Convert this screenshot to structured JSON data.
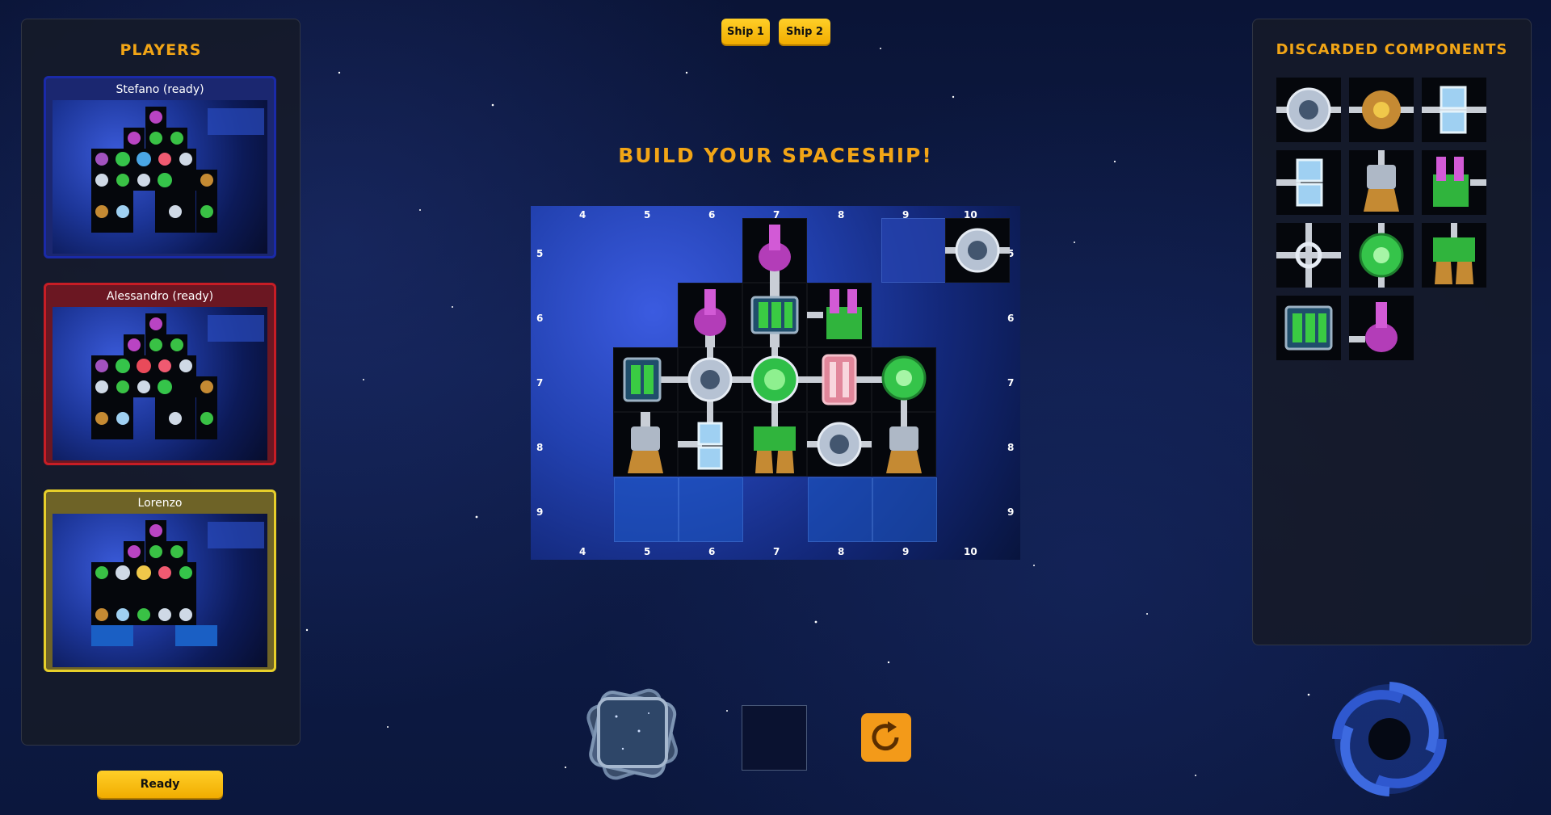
{
  "tabs": [
    {
      "label": "Ship 1"
    },
    {
      "label": "Ship 2"
    }
  ],
  "players_panel": {
    "title": "Players",
    "players": [
      {
        "name": "Stefano (ready)",
        "border": "#1a2aa8",
        "bg": "#1b2770"
      },
      {
        "name": "Alessandro (ready)",
        "border": "#c71d25",
        "bg": "#6b1722"
      },
      {
        "name": "Lorenzo",
        "border": "#e7cf2a",
        "bg": "#6e6327"
      }
    ]
  },
  "ready_button": "Ready",
  "main": {
    "title": "BUILD YOUR SPACESHIP!",
    "columns": [
      "4",
      "5",
      "6",
      "7",
      "8",
      "9",
      "10"
    ],
    "rows": [
      "5",
      "6",
      "7",
      "8",
      "9"
    ]
  },
  "discard_panel": {
    "title": "Discarded Components",
    "items": [
      "cabin-component",
      "battery-component",
      "storage-component",
      "storage-component",
      "engine-component",
      "cannon-component",
      "pipe-connector-component",
      "alien-cabin-component",
      "engine-component",
      "battery-component",
      "cannon-component"
    ]
  },
  "bottom": {
    "deck_icon": "card-deck-icon",
    "held_slot": "held-component-slot",
    "rotate_icon": "rotate-icon",
    "wormhole_icon": "black-hole-icon"
  },
  "colors": {
    "accent": "#f2a516",
    "button": "#ffc914",
    "board_blue": "#1c3597"
  }
}
